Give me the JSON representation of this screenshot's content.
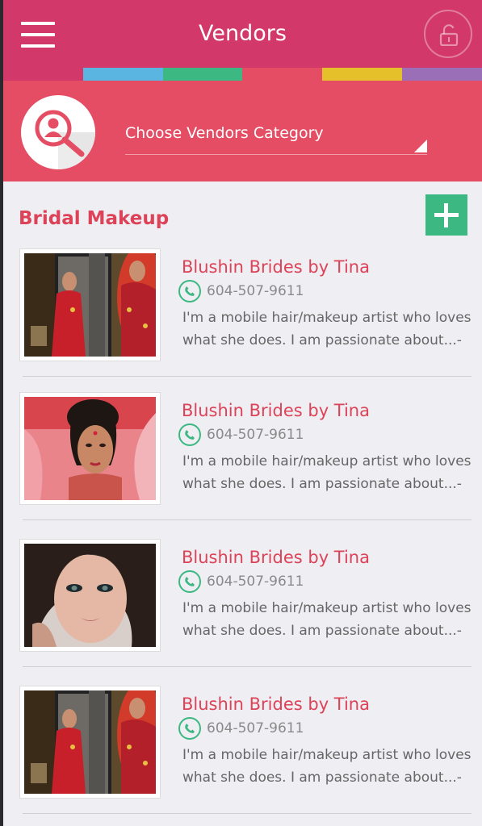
{
  "header": {
    "title": "Vendors",
    "menu_icon": "hamburger-menu-icon",
    "lock_icon": "lock-icon"
  },
  "color_strip": [
    "#d2386a",
    "#5bb5e1",
    "#3cb882",
    "#e44d63",
    "#e6c02a",
    "#9a6fb8"
  ],
  "category": {
    "icon": "user-search-icon",
    "label": "Choose Vendors Category"
  },
  "section": {
    "title": "Bridal Makeup",
    "add_icon": "plus-icon"
  },
  "vendors": [
    {
      "name": "Blushin Brides by Tina",
      "phone": "604-507-9611",
      "description_line1": "I'm a mobile hair/makeup artist who loves",
      "description_line2": "what she does. I am passionate about...-"
    },
    {
      "name": "Blushin Brides by Tina",
      "phone": "604-507-9611",
      "description_line1": "I'm a mobile hair/makeup artist who loves",
      "description_line2": "what she does. I am passionate about...-"
    },
    {
      "name": "Blushin Brides by Tina",
      "phone": "604-507-9611",
      "description_line1": "I'm a mobile hair/makeup artist who loves",
      "description_line2": "what she does. I am passionate about...-"
    },
    {
      "name": "Blushin Brides by Tina",
      "phone": "604-507-9611",
      "description_line1": "I'm a mobile hair/makeup artist who loves",
      "description_line2": "what she does. I am passionate about...-"
    }
  ],
  "colors": {
    "header": "#d2386a",
    "panel": "#e44d63",
    "accent_text": "#dc4258",
    "add_button": "#3cb882"
  }
}
